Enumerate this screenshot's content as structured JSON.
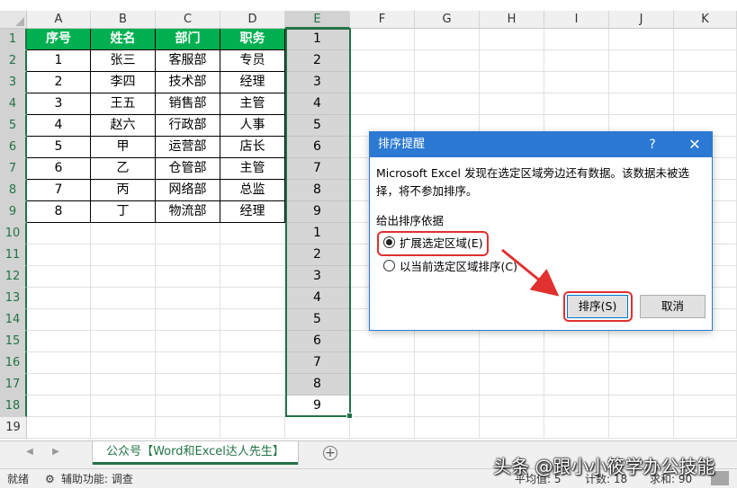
{
  "columns": [
    "A",
    "B",
    "C",
    "D",
    "E",
    "F",
    "G",
    "H",
    "I",
    "J",
    "K"
  ],
  "rows": [
    "1",
    "2",
    "3",
    "4",
    "5",
    "6",
    "7",
    "8",
    "9",
    "10",
    "11",
    "12",
    "13",
    "14",
    "15",
    "16",
    "17",
    "18",
    "19"
  ],
  "table": {
    "headers": [
      "序号",
      "姓名",
      "部门",
      "职务"
    ],
    "rows": [
      [
        "1",
        "张三",
        "客服部",
        "专员"
      ],
      [
        "2",
        "李四",
        "技术部",
        "经理"
      ],
      [
        "3",
        "王五",
        "销售部",
        "主管"
      ],
      [
        "4",
        "赵六",
        "行政部",
        "人事"
      ],
      [
        "5",
        "甲",
        "运营部",
        "店长"
      ],
      [
        "6",
        "乙",
        "仓管部",
        "主管"
      ],
      [
        "7",
        "丙",
        "网络部",
        "总监"
      ],
      [
        "8",
        "丁",
        "物流部",
        "经理"
      ]
    ]
  },
  "column_e": [
    "1",
    "2",
    "3",
    "4",
    "5",
    "6",
    "7",
    "8",
    "9",
    "1",
    "2",
    "3",
    "4",
    "5",
    "6",
    "7",
    "8",
    "9"
  ],
  "dialog": {
    "title": "排序提醒",
    "help": "?",
    "close": "✕",
    "message": "Microsoft Excel 发现在选定区域旁边还有数据。该数据未被选择，将不参加排序。",
    "group_label": "给出排序依据",
    "option_expand": "扩展选定区域(E)",
    "option_current": "以当前选定区域排序(C)",
    "sort_button": "排序(S)",
    "cancel_button": "取消"
  },
  "sheet_tab": "公众号【Word和Excel达人先生】",
  "add_sheet": "⊕",
  "status": {
    "ready": "就绪",
    "accessibility": "辅助功能: 调查",
    "average": "平均值: 5",
    "count": "计数: 18",
    "sum": "求和: 90"
  },
  "watermark": "头条 @跟小小筱学办公技能",
  "colors": {
    "header_green": "#00b050",
    "excel_green": "#217346",
    "dialog_blue": "#2b79d3",
    "highlight_red": "#e03030"
  }
}
